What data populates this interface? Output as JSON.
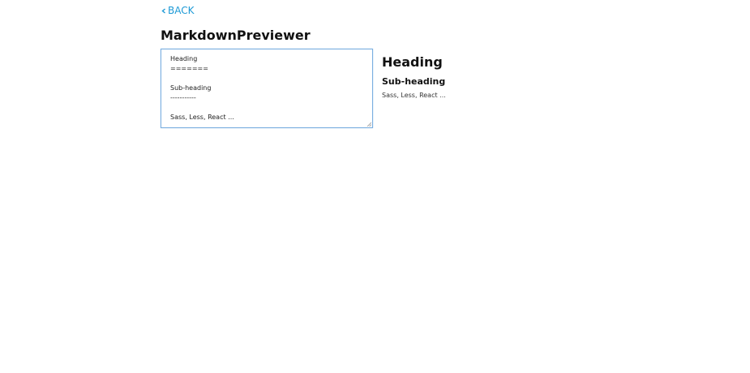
{
  "nav": {
    "back_label": "BACK",
    "back_icon": "chevron-left-icon",
    "accent_color": "#1e9ad6"
  },
  "page": {
    "title": "MarkdownPreviewer"
  },
  "editor": {
    "value": "Heading\n=======\n\nSub-heading\n-----------\n\nSass, Less, React ..."
  },
  "preview": {
    "heading": "Heading",
    "subheading": "Sub-heading",
    "paragraph": "Sass, Less, React ..."
  }
}
